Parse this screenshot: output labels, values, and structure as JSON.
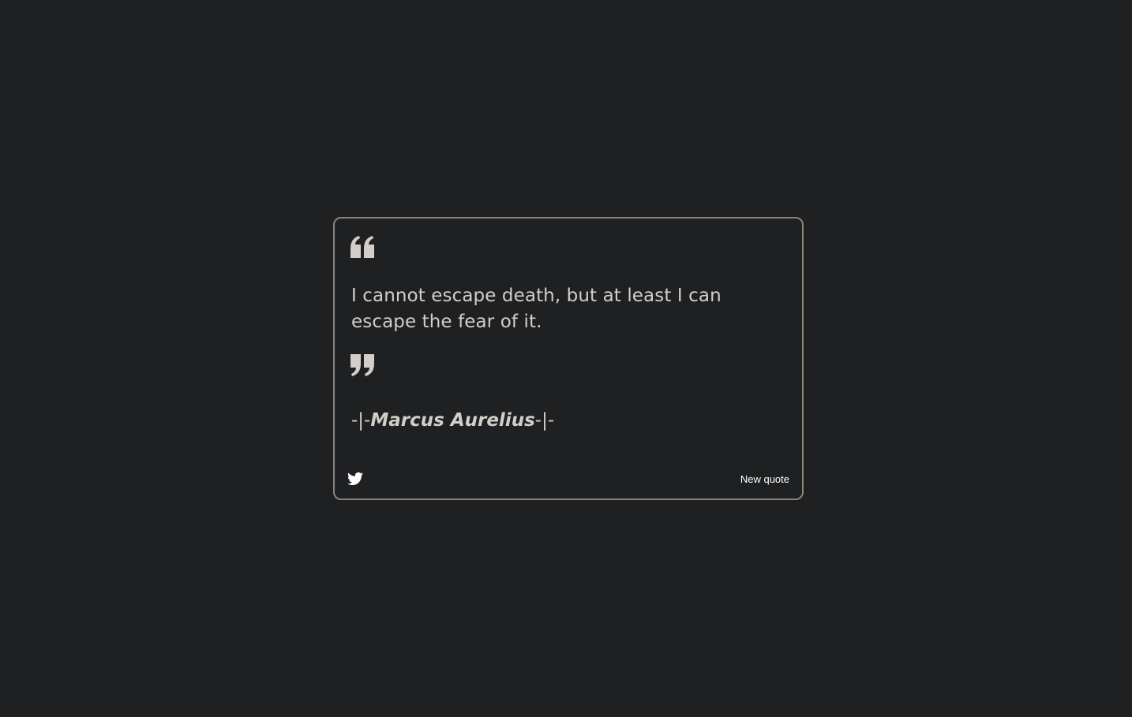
{
  "quote": {
    "text": "I cannot escape death, but at least I can escape the fear of it.",
    "author": {
      "prefix": "-|-",
      "name": "Marcus Aurelius",
      "suffix": "-|-"
    }
  },
  "actions": {
    "tweet_icon": "twitter-icon",
    "new_quote_label": "New quote"
  },
  "icons": {
    "open": "quote-left-icon",
    "close": "quote-right-icon"
  },
  "colors": {
    "background": "#1f2022",
    "border": "#8a847b",
    "text": "#d2cfc8",
    "button_text": "#ffffff"
  }
}
